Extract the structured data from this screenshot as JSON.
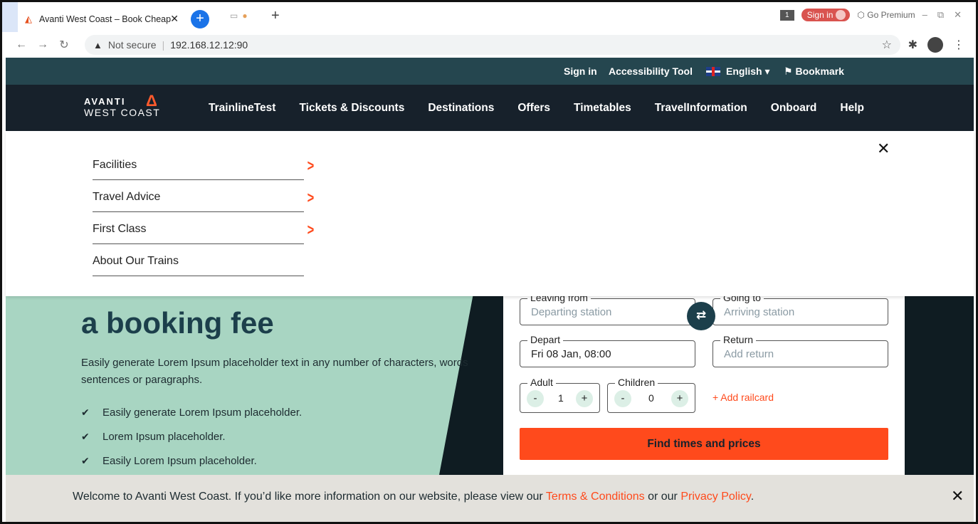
{
  "browser": {
    "tab_title": "Avanti West Coast – Book Cheap",
    "tab_close": "✕",
    "tab_count": "1",
    "sign_in_pill": "Sign in",
    "go_premium": "Go Premium",
    "security_label": "Not secure",
    "url": "192.168.12.12:90"
  },
  "utility_nav": {
    "sign_in": "Sign in",
    "accessibility": "Accessibility Tool",
    "language": "English",
    "bookmark": "Bookmark"
  },
  "logo": {
    "line1": "AVANTI",
    "line2": "WEST COAST"
  },
  "main_nav": [
    "TrainlineTest",
    "Tickets & Discounts",
    "Destinations",
    "Offers",
    "Timetables",
    "TravelInformation",
    "Onboard",
    "Help"
  ],
  "mega_menu": {
    "items": [
      {
        "label": "Facilities",
        "has_submenu": true
      },
      {
        "label": "Travel Advice",
        "has_submenu": true
      },
      {
        "label": "First Class",
        "has_submenu": true
      },
      {
        "label": "About Our Trains",
        "has_submenu": false
      }
    ]
  },
  "hero": {
    "title_line_visible": "a booking fee",
    "description": "Easily generate Lorem Ipsum placeholder text in any number of characters, words sentences or paragraphs.",
    "bullets": [
      "Easily generate Lorem Ipsum placeholder.",
      "Lorem Ipsum placeholder.",
      "Easily Lorem Ipsum placeholder."
    ]
  },
  "booking": {
    "leaving_from_label": "Leaving from",
    "leaving_from_placeholder": "Departing station",
    "going_to_label": "Going to",
    "going_to_placeholder": "Arriving station",
    "depart_label": "Depart",
    "depart_value": "Fri 08 Jan, 08:00",
    "return_label": "Return",
    "return_placeholder": "Add return",
    "adult_label": "Adult",
    "adult_count": "1",
    "children_label": "Children",
    "children_count": "0",
    "add_railcard": "+ Add railcard",
    "submit": "Find times and prices"
  },
  "cookie_banner": {
    "text_before": "Welcome to Avanti West Coast. If you’d like more information on our website, please view our ",
    "terms_link": "Terms & Conditions",
    "text_middle": " or our ",
    "privacy_link": "Privacy Policy",
    "text_after": "."
  },
  "colors": {
    "accent": "#ff4a1c",
    "utility_bar": "#25464f",
    "nav_bg": "#17212b",
    "hero_green": "#a8d5c2"
  }
}
